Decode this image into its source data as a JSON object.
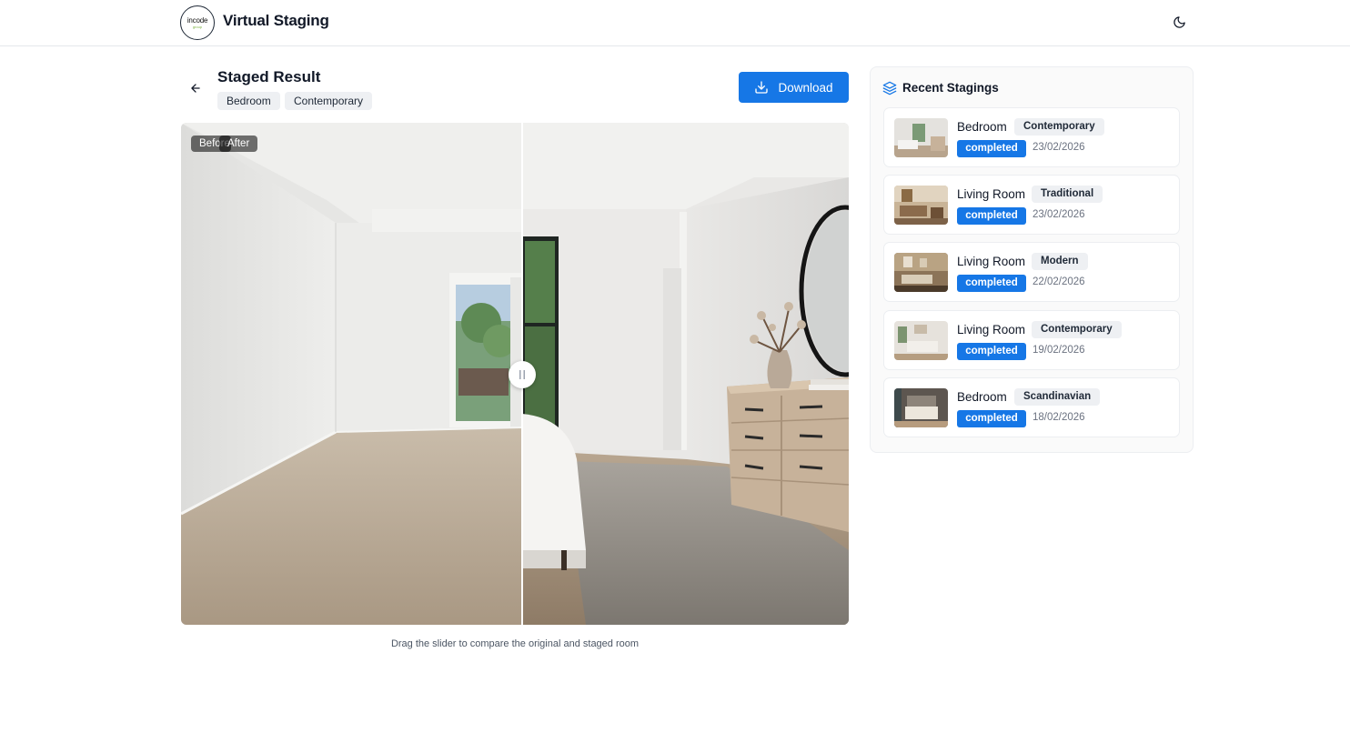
{
  "app": {
    "logo_text": "incode",
    "logo_sub": "group",
    "title": "Virtual Staging"
  },
  "result": {
    "title": "Staged Result",
    "room": "Bedroom",
    "style": "Contemporary",
    "download_label": "Download",
    "before_label": "Before",
    "after_label": "After",
    "slider_position": 0.51,
    "hint": "Drag the slider to compare the original and staged room"
  },
  "sidebar": {
    "title": "Recent Stagings",
    "items": [
      {
        "room": "Bedroom",
        "style": "Contemporary",
        "status": "completed",
        "date": "23/02/2026"
      },
      {
        "room": "Living Room",
        "style": "Traditional",
        "status": "completed",
        "date": "23/02/2026"
      },
      {
        "room": "Living Room",
        "style": "Modern",
        "status": "completed",
        "date": "22/02/2026"
      },
      {
        "room": "Living Room",
        "style": "Contemporary",
        "status": "completed",
        "date": "19/02/2026"
      },
      {
        "room": "Bedroom",
        "style": "Scandinavian",
        "status": "completed",
        "date": "18/02/2026"
      }
    ]
  },
  "colors": {
    "accent": "#1677e6",
    "tag_bg": "#eef0f3",
    "border": "#e5e7eb"
  }
}
